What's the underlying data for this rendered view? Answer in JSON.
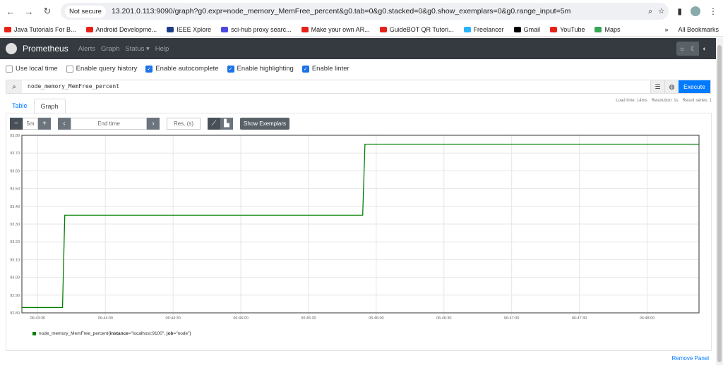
{
  "browser": {
    "security": "Not secure",
    "url": "13.201.0.113:9090/graph?g0.expr=node_memory_MemFree_percent&g0.tab=0&g0.stacked=0&g0.show_exemplars=0&g0.range_input=5m",
    "bookmarks": [
      {
        "label": "Java Tutorials For B...",
        "color": "#e62117"
      },
      {
        "label": "Android Developme...",
        "color": "#e62117"
      },
      {
        "label": "IEEE Xplore",
        "color": "#1f3c88"
      },
      {
        "label": "sci-hub proxy searc...",
        "color": "#4a4ae0"
      },
      {
        "label": "Make your own AR...",
        "color": "#e62117"
      },
      {
        "label": "GuideBOT QR Tutori...",
        "color": "#e62117"
      },
      {
        "label": "Freelancer",
        "color": "#29b2fe"
      },
      {
        "label": "Gmail",
        "color": "#000000"
      },
      {
        "label": "YouTube",
        "color": "#e62117"
      },
      {
        "label": "Maps",
        "color": "#34a853"
      }
    ],
    "all_bookmarks": "All Bookmarks"
  },
  "nav": {
    "brand": "Prometheus",
    "links": [
      "Alerts",
      "Graph",
      "Status ▾",
      "Help"
    ]
  },
  "options": [
    {
      "label": "Use local time",
      "checked": false
    },
    {
      "label": "Enable query history",
      "checked": false
    },
    {
      "label": "Enable autocomplete",
      "checked": true
    },
    {
      "label": "Enable highlighting",
      "checked": true
    },
    {
      "label": "Enable linter",
      "checked": true
    }
  ],
  "query": {
    "expr": "node_memory_MemFree_percent",
    "execute": "Execute"
  },
  "tabs": [
    "Table",
    "Graph"
  ],
  "stats": {
    "load": "Load time: 14ms",
    "resolution": "Resolution: 1s",
    "series": "Result series: 1"
  },
  "controls": {
    "range": "5m",
    "end_placeholder": "End time",
    "res_placeholder": "Res. (s)",
    "exemplars": "Show Exemplars"
  },
  "chart_data": {
    "type": "line",
    "ylim": [
      92.8,
      93.8
    ],
    "yticks": [
      "92.80",
      "92.90",
      "93.00",
      "93.10",
      "93.20",
      "93.30",
      "93.40",
      "93.50",
      "93.60",
      "93.70",
      "93.80"
    ],
    "xlim": [
      "06:43:23",
      "06:48:23"
    ],
    "xticks": [
      "06:43:30",
      "06:44:00",
      "06:44:30",
      "06:45:00",
      "06:45:30",
      "06:46:00",
      "06:46:30",
      "06:47:00",
      "06:47:30",
      "06:48:00"
    ],
    "series": [
      {
        "name": "node_memory_MemFree_percent{instance=\"localhost:9100\", job=\"node\"}",
        "color": "#008000",
        "points": [
          [
            "06:43:23",
            92.83
          ],
          [
            "06:43:41",
            92.83
          ],
          [
            "06:43:42",
            93.35
          ],
          [
            "06:45:54",
            93.35
          ],
          [
            "06:45:55",
            93.75
          ],
          [
            "06:48:23",
            93.75
          ]
        ]
      }
    ]
  },
  "legend": {
    "metric": "node_memory_MemFree_percent",
    "open": "{",
    "k1": "instance",
    "v1": "=\"localhost:9100\", ",
    "k2": "job",
    "v2": "=\"node\"}"
  },
  "remove_panel": "Remove Panel"
}
